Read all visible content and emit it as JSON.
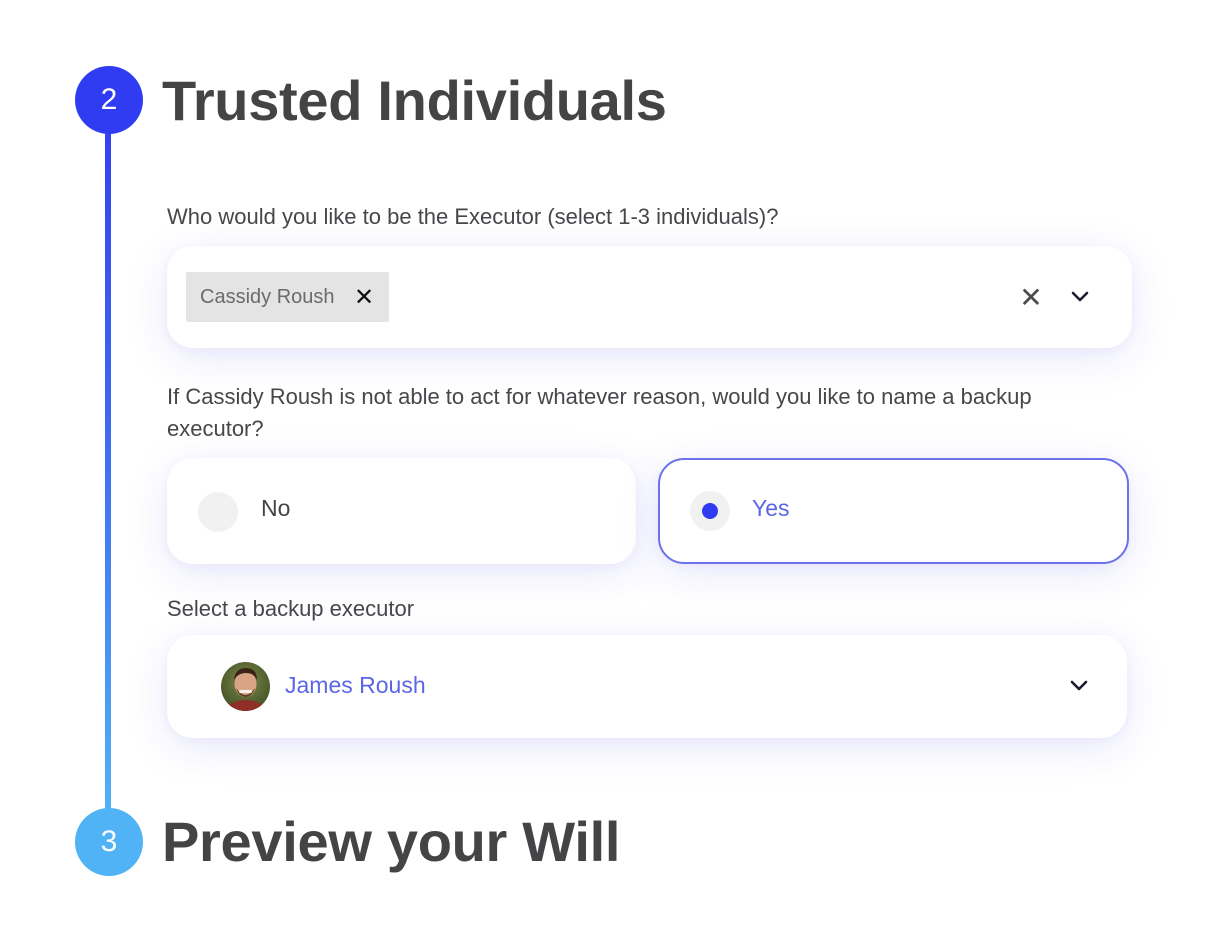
{
  "steps": [
    {
      "number": "2",
      "title": "Trusted Individuals",
      "color": "#2f3cf2"
    },
    {
      "number": "3",
      "title": "Preview your Will",
      "color": "#4fb3f6"
    }
  ],
  "executor": {
    "question": "Who would you like to be the Executor (select 1-3 individuals)?",
    "selected": [
      {
        "label": "Cassidy Roush",
        "remove_icon": "close-icon"
      }
    ],
    "clear_icon": "close-icon",
    "dropdown_icon": "chevron-down-icon"
  },
  "backup_question": {
    "question": "If Cassidy Roush is not able to act for whatever reason, would you like to name a backup executor?",
    "options": [
      {
        "label": "No",
        "selected": false
      },
      {
        "label": "Yes",
        "selected": true
      }
    ]
  },
  "backup_executor": {
    "label": "Select a backup executor",
    "selected_name": "James Roush",
    "avatar": "avatar-photo",
    "dropdown_icon": "chevron-down-icon"
  },
  "colors": {
    "accent": "#2f3cf2",
    "accent_light": "#4fb3f6",
    "selected_text": "#5b66e6",
    "selected_border": "#6a73ea"
  }
}
